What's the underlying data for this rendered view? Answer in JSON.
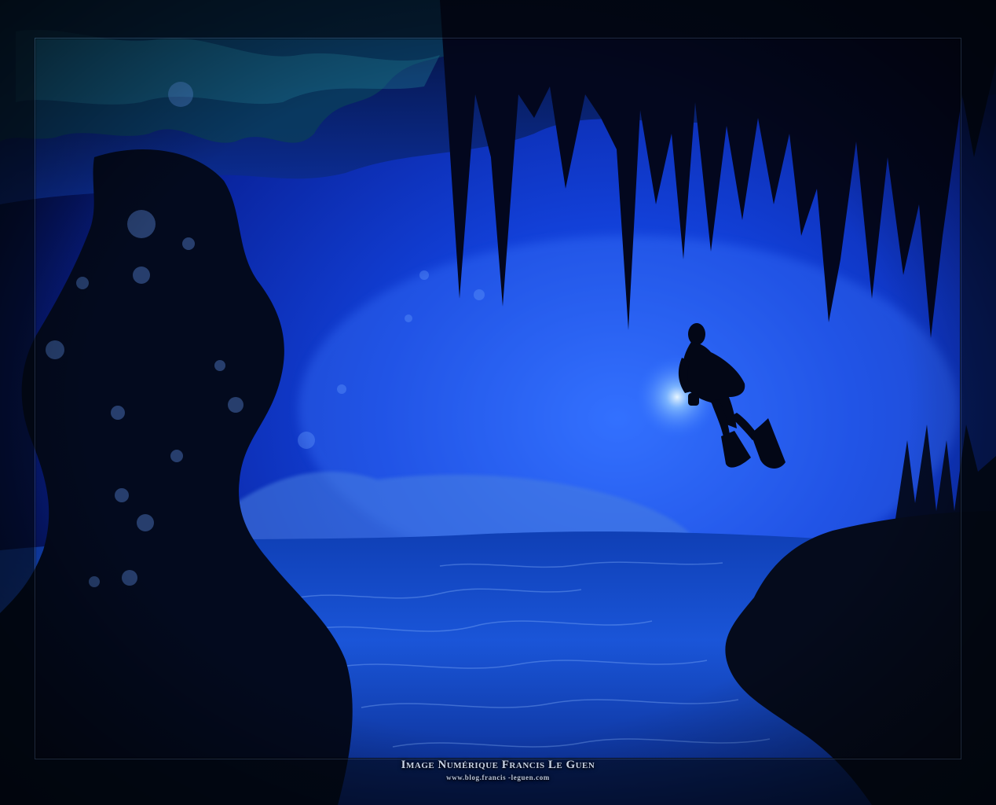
{
  "image": {
    "subject": "scuba-diver",
    "palette": {
      "deep": "#020a2a",
      "mid": "#0a2fb0",
      "bright": "#2a6bff",
      "glow": "#bfe3ff",
      "frame": "#07101c"
    }
  },
  "credit": {
    "title": "Image Numérique Francis Le Guen",
    "url": "www.blog.francis -leguen.com"
  }
}
